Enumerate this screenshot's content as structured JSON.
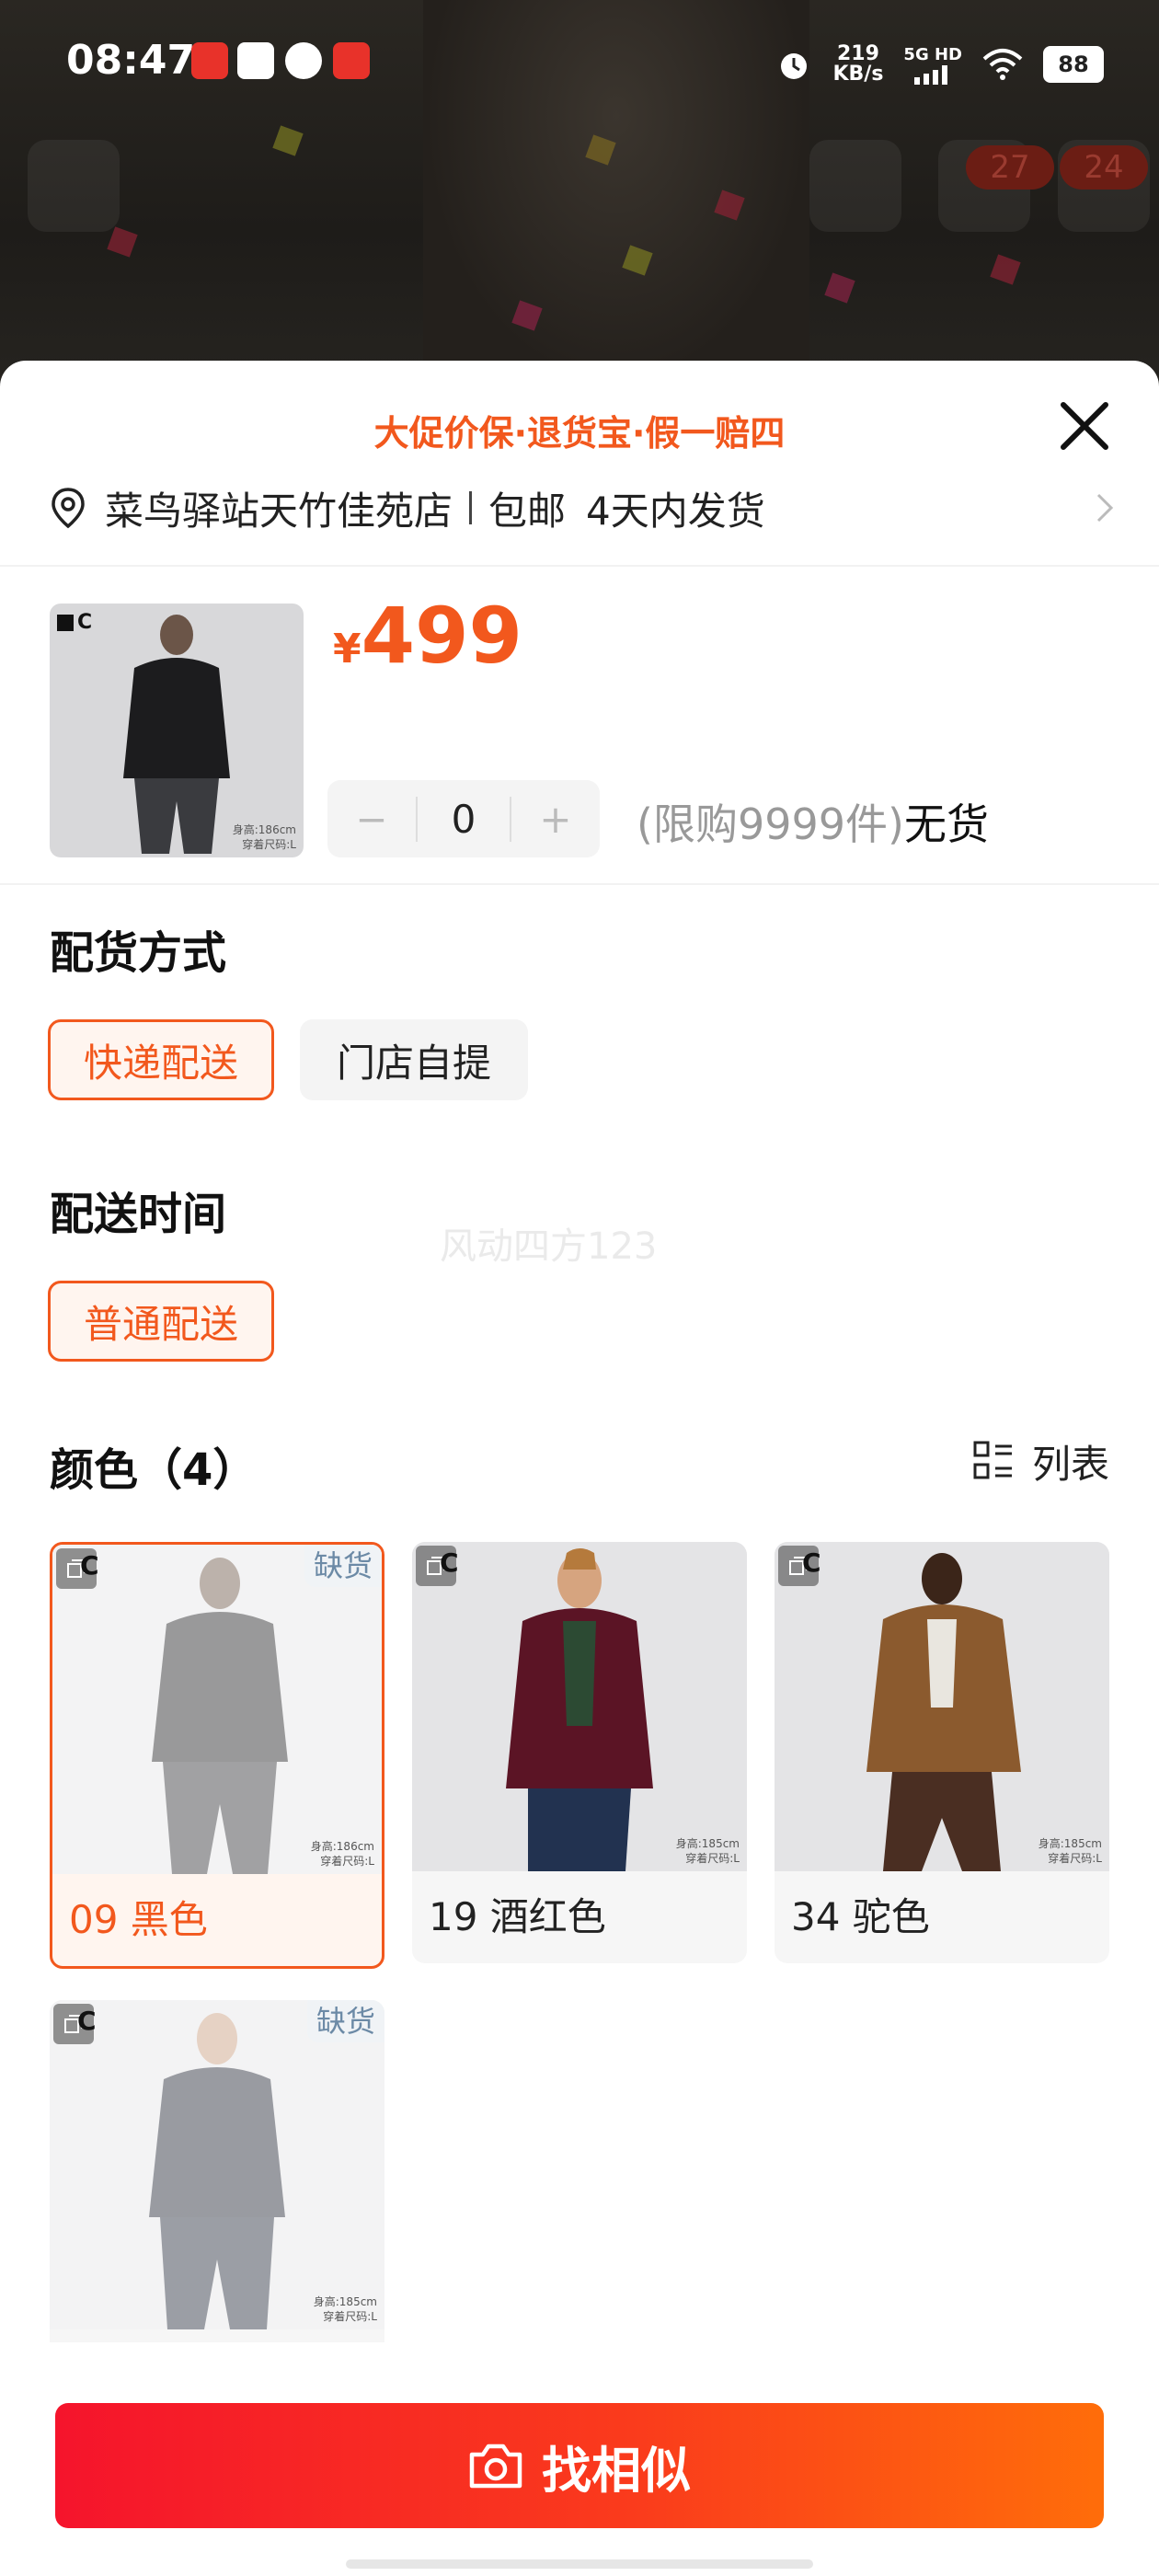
{
  "status_bar": {
    "time": "08:47",
    "net_speed_value": "219",
    "net_speed_unit": "KB/s",
    "network": "5G HD",
    "battery": "88"
  },
  "background": {
    "cart_badge": "27",
    "msg_badge": "24"
  },
  "sheet": {
    "promo_text": "大促价保·退货宝·假一赔四",
    "address": "菜鸟驿站天竹佳苑店",
    "shipping_fee": "包邮",
    "ship_time": "4天内发货"
  },
  "product": {
    "currency": "¥",
    "price": "499",
    "quantity": "0",
    "minus": "−",
    "plus": "+",
    "limit_text": "(限购9999件)",
    "stock_text": "无货",
    "logo_text": "C",
    "size_note_line1": "身高:186cm",
    "size_note_line2": "穿着尺码:L"
  },
  "delivery_method": {
    "title": "配货方式",
    "options": [
      "快递配送",
      "门店自提"
    ],
    "selected": "快递配送"
  },
  "delivery_time": {
    "title": "配送时间",
    "options": [
      "普通配送"
    ],
    "selected": "普通配送"
  },
  "watermark": "风动四方123",
  "colors": {
    "title": "颜色（4）",
    "list_toggle": "列表",
    "out_of_stock": "缺货",
    "items": [
      {
        "label": "09 黑色",
        "selected": true,
        "out_of_stock": true,
        "size_note_line1": "身高:186cm",
        "size_note_line2": "穿着尺码:L"
      },
      {
        "label": "19 酒红色",
        "selected": false,
        "out_of_stock": false,
        "size_note_line1": "身高:185cm",
        "size_note_line2": "穿着尺码:L"
      },
      {
        "label": "34 驼色",
        "selected": false,
        "out_of_stock": false,
        "size_note_line1": "身高:185cm",
        "size_note_line2": "穿着尺码:L"
      },
      {
        "label": "",
        "selected": false,
        "out_of_stock": true,
        "size_note_line1": "身高:185cm",
        "size_note_line2": "穿着尺码:L"
      }
    ]
  },
  "cta": {
    "label": "找相似"
  },
  "theme": {
    "accent": "#f2581d",
    "cta_start": "#f5142c",
    "cta_end": "#ff6d0a",
    "oos_text": "#6c8aa6"
  }
}
